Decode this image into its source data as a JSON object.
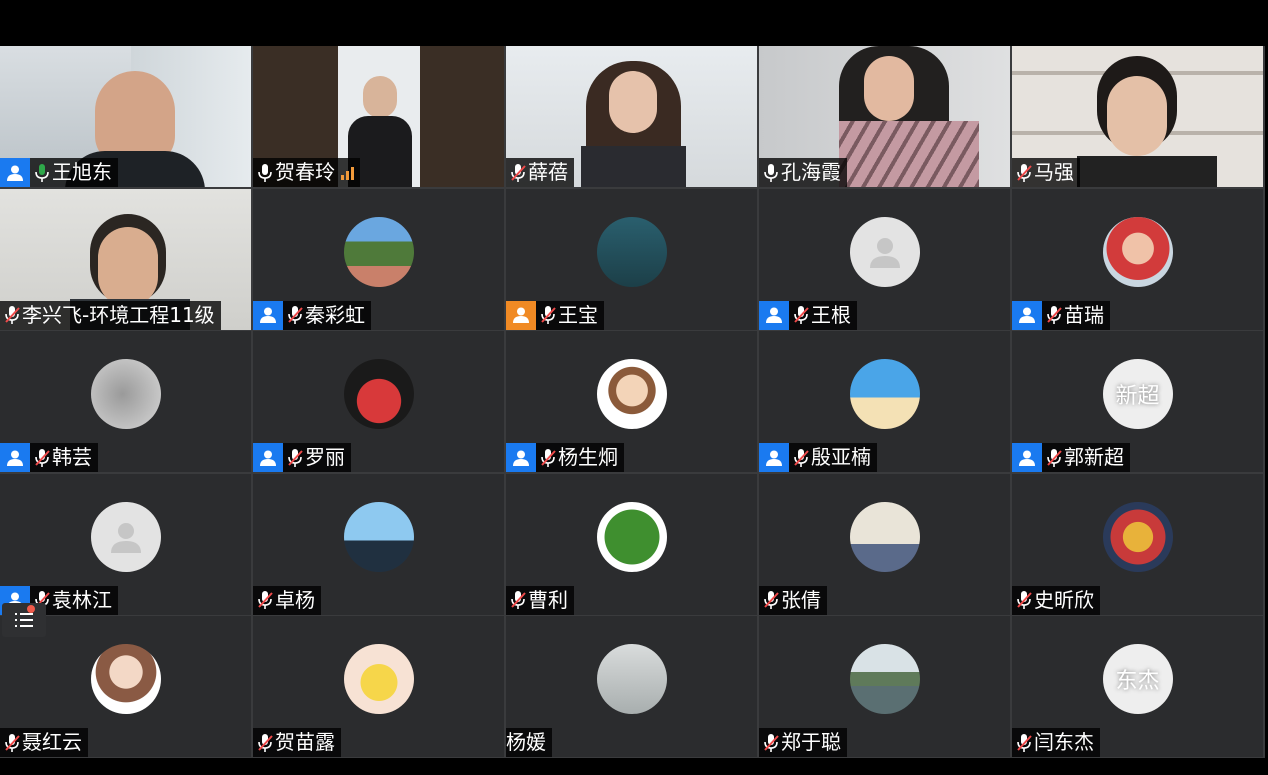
{
  "colors": {
    "role_host": "#1a7af0",
    "role_cohost": "#f08a24",
    "speaking_mic": "#2ea84a"
  },
  "participants": [
    {
      "name": "王旭东",
      "mic": "speaking",
      "role": "host",
      "scene": "video-office"
    },
    {
      "name": "贺春玲",
      "mic": "on",
      "role": "",
      "scene": "video-dark",
      "signal": "weak"
    },
    {
      "name": "薛蓓",
      "mic": "muted",
      "role": "",
      "scene": "video-room"
    },
    {
      "name": "孔海霞",
      "mic": "on",
      "role": "",
      "scene": "video-wall"
    },
    {
      "name": "马强",
      "mic": "muted",
      "role": "",
      "scene": "video-shelf"
    },
    {
      "name": "李兴飞-环境工程11级",
      "mic": "muted",
      "role": "",
      "scene": "video-plain"
    },
    {
      "name": "秦彩虹",
      "mic": "muted",
      "role": "host",
      "avatar": "landscape"
    },
    {
      "name": "王宝",
      "mic": "muted",
      "role": "cohost",
      "avatar": "boat"
    },
    {
      "name": "王根",
      "mic": "muted",
      "role": "host",
      "avatar": "default"
    },
    {
      "name": "苗瑞",
      "mic": "muted",
      "role": "host",
      "avatar": "baby"
    },
    {
      "name": "韩芸",
      "mic": "muted",
      "role": "host",
      "avatar": "cat"
    },
    {
      "name": "罗丽",
      "mic": "muted",
      "role": "host",
      "avatar": "family"
    },
    {
      "name": "杨生炯",
      "mic": "muted",
      "role": "host",
      "avatar": "cartoon"
    },
    {
      "name": "殷亚楠",
      "mic": "muted",
      "role": "host",
      "avatar": "beach"
    },
    {
      "name": "郭新超",
      "mic": "muted",
      "role": "host",
      "avatar": "text",
      "avatar_text": "新超"
    },
    {
      "name": "袁林江",
      "mic": "muted",
      "role": "host",
      "avatar": "default"
    },
    {
      "name": "卓杨",
      "mic": "muted",
      "role": "",
      "avatar": "person-sky"
    },
    {
      "name": "曹利",
      "mic": "muted",
      "role": "",
      "avatar": "leaf"
    },
    {
      "name": "张倩",
      "mic": "muted",
      "role": "",
      "avatar": "comic"
    },
    {
      "name": "史昕欣",
      "mic": "muted",
      "role": "",
      "avatar": "anime"
    },
    {
      "name": "聂红云",
      "mic": "muted",
      "role": "",
      "avatar": "girl-drawing"
    },
    {
      "name": "贺苗露",
      "mic": "muted",
      "role": "",
      "avatar": "duck"
    },
    {
      "name": "杨媛",
      "mic": "none",
      "role": "",
      "avatar": "snow"
    },
    {
      "name": "郑于聪",
      "mic": "muted",
      "role": "",
      "avatar": "lake"
    },
    {
      "name": "闫东杰",
      "mic": "muted",
      "role": "",
      "avatar": "text",
      "avatar_text": "东杰"
    }
  ],
  "participant_list_button": {
    "icon": "list-icon",
    "has_notification": true
  }
}
